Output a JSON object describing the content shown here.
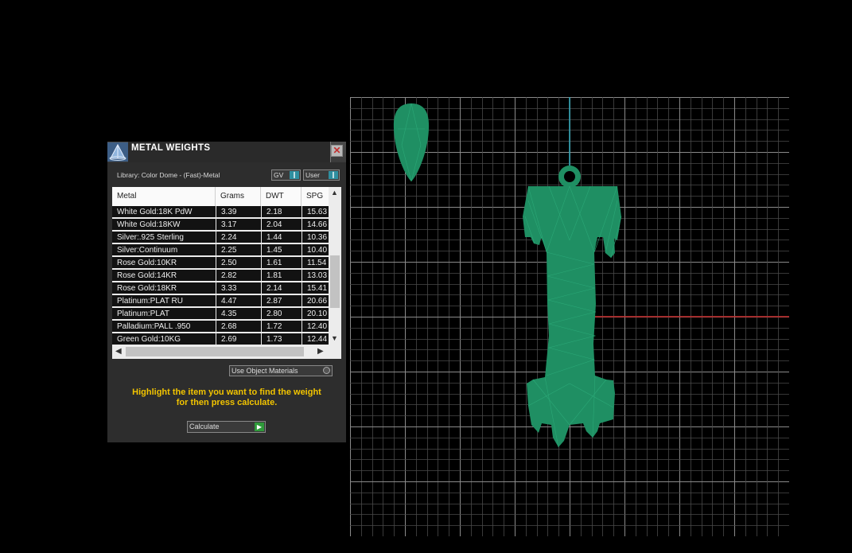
{
  "panel": {
    "title": "METAL WEIGHTS",
    "library": "Library: Color Dome - (Fast)-Metal",
    "toggle_gv": "GV",
    "toggle_user": "User",
    "columns": [
      "Metal",
      "Grams",
      "DWT",
      "SPG"
    ],
    "rows": [
      {
        "metal": "White Gold:18K PdW",
        "grams": "3.39",
        "dwt": "2.18",
        "spg": "15.63"
      },
      {
        "metal": "White Gold:18KW",
        "grams": "3.17",
        "dwt": "2.04",
        "spg": "14.66"
      },
      {
        "metal": "Silver:.925 Sterling",
        "grams": "2.24",
        "dwt": "1.44",
        "spg": "10.36"
      },
      {
        "metal": "Silver:Continuum",
        "grams": "2.25",
        "dwt": "1.45",
        "spg": "10.40"
      },
      {
        "metal": "Rose Gold:10KR",
        "grams": "2.50",
        "dwt": "1.61",
        "spg": "11.54"
      },
      {
        "metal": "Rose Gold:14KR",
        "grams": "2.82",
        "dwt": "1.81",
        "spg": "13.03"
      },
      {
        "metal": "Rose Gold:18KR",
        "grams": "3.33",
        "dwt": "2.14",
        "spg": "15.41"
      },
      {
        "metal": "Platinum:PLAT RU",
        "grams": "4.47",
        "dwt": "2.87",
        "spg": "20.66"
      },
      {
        "metal": "Platinum:PLAT",
        "grams": "4.35",
        "dwt": "2.80",
        "spg": "20.10"
      },
      {
        "metal": "Palladium:PALL .950",
        "grams": "2.68",
        "dwt": "1.72",
        "spg": "12.40"
      },
      {
        "metal": "Green Gold:10KG",
        "grams": "2.69",
        "dwt": "1.73",
        "spg": "12.44"
      }
    ],
    "use_object_materials": "Use Object Materials",
    "hint_line1": "Highlight the item you want to find the weight",
    "hint_line2": "for then press calculate.",
    "calculate": "Calculate"
  },
  "icons": {
    "app": "pyramid-icon",
    "close": "close-icon",
    "scroll_up": "chevron-up-icon",
    "scroll_down": "chevron-down-icon",
    "scroll_left": "chevron-left-icon",
    "scroll_right": "chevron-right-icon",
    "calculate": "play-icon"
  },
  "colors": {
    "model": "#1f8f63",
    "grid": "#5a5a5a",
    "axis_y": "#2aa5b8",
    "axis_x": "#c82a2a",
    "hint": "#f2c400"
  }
}
